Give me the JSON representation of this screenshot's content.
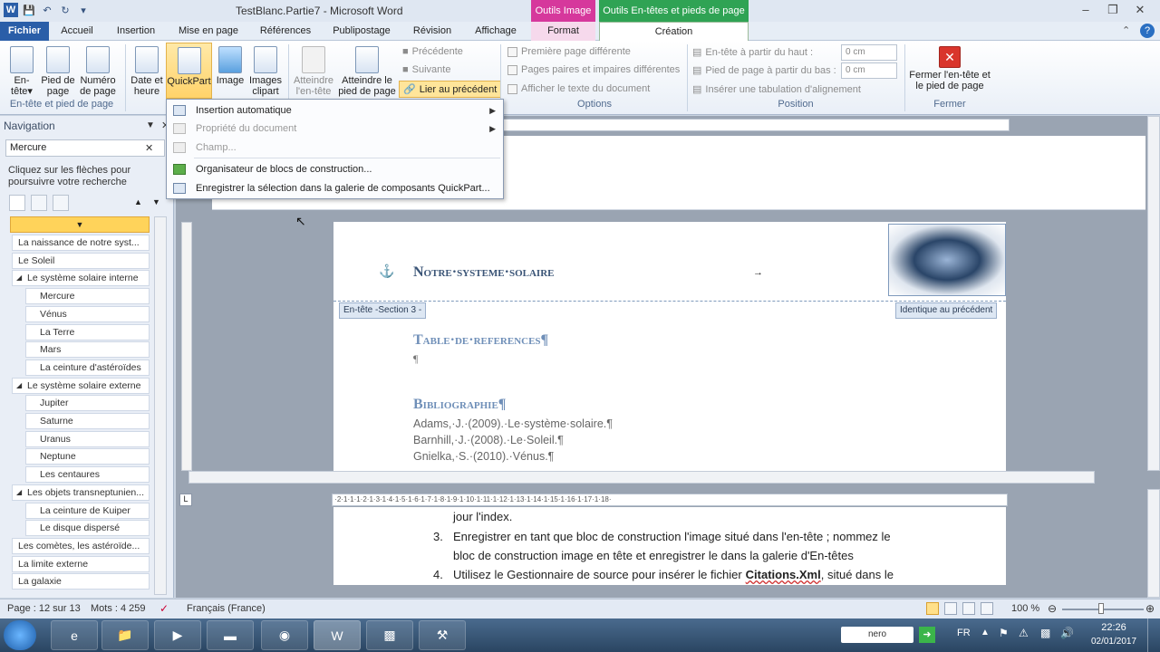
{
  "window": {
    "title": "TestBlanc.Partie7  -  Microsoft Word",
    "context_tab_image": "Outils Image",
    "context_tab_header": "Outils En-têtes et pieds de page"
  },
  "tabs": [
    "Fichier",
    "Accueil",
    "Insertion",
    "Mise en page",
    "Références",
    "Publipostage",
    "Révision",
    "Affichage",
    "Format",
    "Création"
  ],
  "ribbon": {
    "group1_label": "En-tête et pied de page",
    "header_btn": "En-tête",
    "footer_btn": "Pied de page",
    "pagenum_btn": "Numéro de page",
    "date_btn": "Date et heure",
    "quickpart_btn": "QuickPart",
    "image_btn": "Image",
    "clipart_btn": "Images clipart",
    "goto_header_btn": "Atteindre l'en-tête",
    "goto_footer_btn": "Atteindre le pied de page",
    "prev_btn": "Précédente",
    "next_btn": "Suivante",
    "link_prev_btn": "Lier au précédent",
    "options_label": "Options",
    "opt_first_page": "Première page différente",
    "opt_odd_even": "Pages paires et impaires différentes",
    "opt_show_text": "Afficher le texte du document",
    "position_label": "Position",
    "pos_header_top": "En-tête à partir du haut :",
    "pos_footer_bottom": "Pied de page à partir du bas :",
    "pos_header_val": "0 cm",
    "pos_footer_val": "0 cm",
    "pos_insert_tab": "Insérer une tabulation d'alignement",
    "close_label": "Fermer",
    "close_btn": "Fermer l'en-tête et le pied de page"
  },
  "quickpart_menu": [
    {
      "label": "Insertion automatique",
      "enabled": true,
      "submenu": true
    },
    {
      "label": "Propriété du document",
      "enabled": false,
      "submenu": true
    },
    {
      "label": "Champ...",
      "enabled": false,
      "submenu": false
    },
    {
      "label": "Organisateur de blocs de construction...",
      "enabled": true,
      "submenu": false
    },
    {
      "label": "Enregistrer la sélection dans la galerie de composants QuickPart...",
      "enabled": true,
      "submenu": false
    }
  ],
  "nav": {
    "title": "Navigation",
    "search_value": "Mercure",
    "hint": "Cliquez sur les flèches pour poursuivre votre recherche",
    "items": [
      {
        "label": "La naissance de notre syst...",
        "level": 1
      },
      {
        "label": "Le Soleil",
        "level": 1
      },
      {
        "label": "Le système solaire interne",
        "level": 1
      },
      {
        "label": "Mercure",
        "level": 2
      },
      {
        "label": "Vénus",
        "level": 2
      },
      {
        "label": "La Terre",
        "level": 2
      },
      {
        "label": "Mars",
        "level": 2
      },
      {
        "label": "La ceinture d'astéroïdes",
        "level": 2
      },
      {
        "label": "Le système solaire externe",
        "level": 1
      },
      {
        "label": "Jupiter",
        "level": 2
      },
      {
        "label": "Saturne",
        "level": 2
      },
      {
        "label": "Uranus",
        "level": 2
      },
      {
        "label": "Neptune",
        "level": 2
      },
      {
        "label": "Les centaures",
        "level": 2
      },
      {
        "label": "Les objets transneptunien...",
        "level": 1
      },
      {
        "label": "La ceinture de Kuiper",
        "level": 2
      },
      {
        "label": "Le disque dispersé",
        "level": 2
      },
      {
        "label": "Les comètes, les astéroïde...",
        "level": 1
      },
      {
        "label": "La limite externe",
        "level": 1
      },
      {
        "label": "La galaxie",
        "level": 1
      }
    ]
  },
  "document": {
    "header_title": "Notre·systeme·solaire",
    "header_tag": "En-tête -Section 3 -",
    "same_as_prev": "Identique au précédent",
    "toc_title": "Table·de·references¶",
    "pilcrow": "¶",
    "biblio_title": "Bibliographie¶",
    "biblio": [
      "Adams,·J.·(2009).·Le·système·solaire.¶",
      "Barnhill,·J.·(2008).·Le·Soleil.¶",
      "Gnielka,·S.·(2010).·Vénus.¶"
    ],
    "list_line1": "jour l'index.",
    "list_item3_num": "3.",
    "list_item3_a": "Enregistrer en tant que bloc de construction  l'image situé dans l'en-tête ; nommez le",
    "list_item3_b": "bloc de construction image en tête et enregistrer le dans la galerie d'En-têtes",
    "list_item4_num": "4.",
    "list_item4_a": "Utilisez le Gestionnaire de source pour  insérer le fichier",
    "list_item4_file": "Citations.Xml",
    "list_item4_b": ", situé dans le"
  },
  "status": {
    "page": "Page : 12 sur 13",
    "words": "Mots : 4 259",
    "lang": "Français (France)",
    "zoom": "100 %"
  },
  "taskbar": {
    "lang": "FR",
    "time": "22:26",
    "date": "02/01/2017",
    "nero": "nero"
  }
}
